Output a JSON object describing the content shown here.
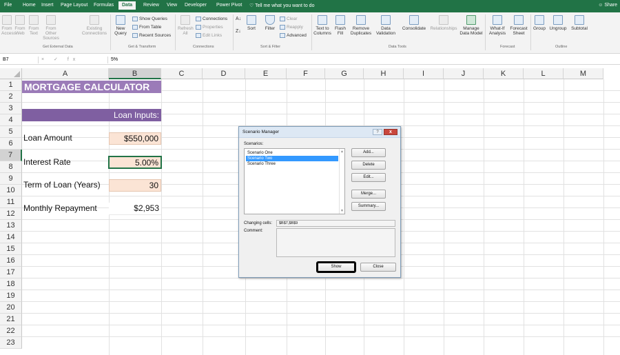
{
  "ribbon": {
    "tabs": [
      {
        "label": "File",
        "active": false
      },
      {
        "label": "Home",
        "active": false
      },
      {
        "label": "Insert",
        "active": false
      },
      {
        "label": "Page Layout",
        "active": false
      },
      {
        "label": "Formulas",
        "active": false
      },
      {
        "label": "Data",
        "active": true
      },
      {
        "label": "Review",
        "active": false
      },
      {
        "label": "View",
        "active": false
      },
      {
        "label": "Developer",
        "active": false
      },
      {
        "label": "Power Pivot",
        "active": false
      }
    ],
    "tell_me": "Tell me what you want to do",
    "share": "Share",
    "buttons": {
      "from_access": "From\nAccess",
      "from_web": "From\nWeb",
      "from_text": "From\nText",
      "from_other": "From Other\nSources",
      "existing": "Existing\nConnections",
      "new_query": "New\nQuery",
      "show_queries": "Show Queries",
      "from_table": "From Table",
      "recent_sources": "Recent Sources",
      "refresh_all": "Refresh\nAll",
      "connections": "Connections",
      "properties": "Properties",
      "edit_links": "Edit Links",
      "sort": "Sort",
      "filter": "Filter",
      "clear": "Clear",
      "reapply": "Reapply",
      "advanced": "Advanced",
      "text_to_columns": "Text to\nColumns",
      "flash_fill": "Flash\nFill",
      "remove_duplicates": "Remove\nDuplicates",
      "data_validation": "Data\nValidation",
      "consolidate": "Consolidate",
      "relationships": "Relationships",
      "manage_data_model": "Manage\nData Model",
      "what_if": "What-If\nAnalysis",
      "forecast_sheet": "Forecast\nSheet",
      "group": "Group",
      "ungroup": "Ungroup",
      "subtotal": "Subtotal"
    },
    "groups": {
      "get_external": "Get External Data",
      "get_transform": "Get & Transform",
      "connections": "Connections",
      "sort_filter": "Sort & Filter",
      "data_tools": "Data Tools",
      "forecast": "Forecast",
      "outline": "Outline"
    }
  },
  "formula_bar": {
    "name_box": "B7",
    "icons": "× ✓ fx",
    "value": "5%"
  },
  "sheet": {
    "columns": [
      "A",
      "B",
      "C",
      "D",
      "E",
      "F",
      "G",
      "H",
      "I",
      "J",
      "K",
      "L",
      "M"
    ],
    "rows": [
      "1",
      "2",
      "3",
      "4",
      "5",
      "6",
      "7",
      "8",
      "9",
      "10",
      "11",
      "12",
      "13",
      "14",
      "15",
      "16",
      "17",
      "18",
      "19",
      "20",
      "21",
      "22",
      "23"
    ],
    "title": "MORTGAGE CALCULATOR",
    "loan_inputs_header": "Loan Inputs:",
    "loan_amount_label": "Loan Amount",
    "loan_amount_value": "$550,000",
    "interest_rate_label": "Interest Rate",
    "interest_rate_value": "5.00%",
    "term_label": "Term of Loan (Years)",
    "term_value": "30",
    "repayment_label": "Monthly Repayment",
    "repayment_value": "$2,953"
  },
  "dialog": {
    "title": "Scenario Manager",
    "help": "?",
    "close": "x",
    "scenarios_label": "Scenarios:",
    "scenarios": [
      {
        "name": "Scenario One",
        "selected": false
      },
      {
        "name": "Scenario Two",
        "selected": true
      },
      {
        "name": "Scenario Three",
        "selected": false
      }
    ],
    "buttons": {
      "add": "Add...",
      "delete": "Delete",
      "edit": "Edit...",
      "merge": "Merge...",
      "summary": "Summary...",
      "show": "Show",
      "close": "Close"
    },
    "changing_cells_label": "Changing cells:",
    "changing_cells_value": "$B$7,$B$9",
    "comment_label": "Comment:"
  }
}
